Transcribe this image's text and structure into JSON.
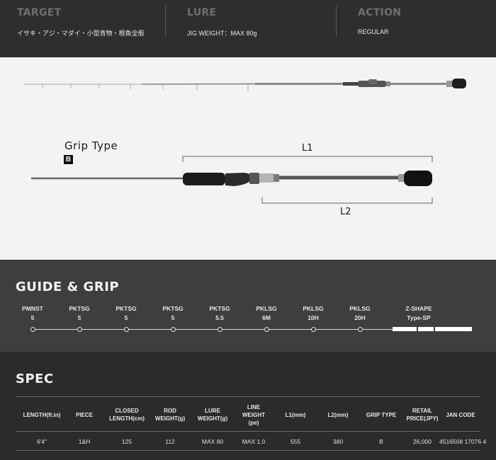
{
  "top": {
    "target": {
      "heading": "TARGET",
      "value": "イサキ・アジ・マダイ・小型青物・根魚全般"
    },
    "lure": {
      "heading": "LURE",
      "value": "JIG WEIGHT：MAX 80g"
    },
    "action": {
      "heading": "ACTION",
      "value": "REGULAR"
    }
  },
  "rod_image": {
    "grip_type_label": "Grip Type",
    "grip_type_value": "B",
    "dim_l1": "L1",
    "dim_l2": "L2"
  },
  "guide_grip": {
    "title": "GUIDE & GRIP",
    "items": [
      {
        "name": "PMNST",
        "size": "5"
      },
      {
        "name": "PKTSG",
        "size": "5"
      },
      {
        "name": "PKTSG",
        "size": "5"
      },
      {
        "name": "PKTSG",
        "size": "5"
      },
      {
        "name": "PKTSG",
        "size": "5.5"
      },
      {
        "name": "PKLSG",
        "size": "6M"
      },
      {
        "name": "PKLSG",
        "size": "10H"
      },
      {
        "name": "PKLSG",
        "size": "20H"
      },
      {
        "name": "Z-SHAPE",
        "size": "Type-SP"
      }
    ]
  },
  "spec": {
    "title": "SPEC",
    "headers": [
      [
        "LENGTH(ft.in)"
      ],
      [
        "PIECE"
      ],
      [
        "CLOSED",
        "LENGTH(cm)"
      ],
      [
        "ROD",
        "WEIGHT(g)"
      ],
      [
        "LURE",
        "WEIGHT(g)"
      ],
      [
        "LINE",
        "WEIGHT",
        "(pe)"
      ],
      [
        "L1(mm)"
      ],
      [
        "L2(mm)"
      ],
      [
        "GRIP TYPE"
      ],
      [
        "RETAIL",
        "PRICE(JPY)"
      ],
      [
        "JAN CODE"
      ]
    ],
    "row": [
      "6'4\"",
      "1&H",
      "125",
      "112",
      "MAX 80",
      "MAX 1.0",
      "555",
      "380",
      "B",
      "26,000",
      "4516508 17076 4"
    ]
  },
  "colors": {
    "dark": "#2b2b2b",
    "band": "#3e3e3e",
    "image_bg": "#f3f3f3"
  }
}
